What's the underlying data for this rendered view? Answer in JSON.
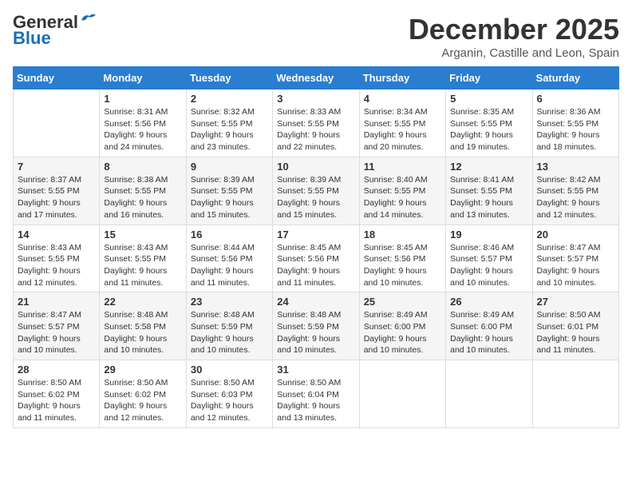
{
  "logo": {
    "line1": "General",
    "line2": "Blue"
  },
  "title": "December 2025",
  "location": "Arganin, Castille and Leon, Spain",
  "days_of_week": [
    "Sunday",
    "Monday",
    "Tuesday",
    "Wednesday",
    "Thursday",
    "Friday",
    "Saturday"
  ],
  "weeks": [
    [
      {
        "day": "",
        "info": ""
      },
      {
        "day": "1",
        "info": "Sunrise: 8:31 AM\nSunset: 5:56 PM\nDaylight: 9 hours\nand 24 minutes."
      },
      {
        "day": "2",
        "info": "Sunrise: 8:32 AM\nSunset: 5:55 PM\nDaylight: 9 hours\nand 23 minutes."
      },
      {
        "day": "3",
        "info": "Sunrise: 8:33 AM\nSunset: 5:55 PM\nDaylight: 9 hours\nand 22 minutes."
      },
      {
        "day": "4",
        "info": "Sunrise: 8:34 AM\nSunset: 5:55 PM\nDaylight: 9 hours\nand 20 minutes."
      },
      {
        "day": "5",
        "info": "Sunrise: 8:35 AM\nSunset: 5:55 PM\nDaylight: 9 hours\nand 19 minutes."
      },
      {
        "day": "6",
        "info": "Sunrise: 8:36 AM\nSunset: 5:55 PM\nDaylight: 9 hours\nand 18 minutes."
      }
    ],
    [
      {
        "day": "7",
        "info": "Sunrise: 8:37 AM\nSunset: 5:55 PM\nDaylight: 9 hours\nand 17 minutes."
      },
      {
        "day": "8",
        "info": "Sunrise: 8:38 AM\nSunset: 5:55 PM\nDaylight: 9 hours\nand 16 minutes."
      },
      {
        "day": "9",
        "info": "Sunrise: 8:39 AM\nSunset: 5:55 PM\nDaylight: 9 hours\nand 15 minutes."
      },
      {
        "day": "10",
        "info": "Sunrise: 8:39 AM\nSunset: 5:55 PM\nDaylight: 9 hours\nand 15 minutes."
      },
      {
        "day": "11",
        "info": "Sunrise: 8:40 AM\nSunset: 5:55 PM\nDaylight: 9 hours\nand 14 minutes."
      },
      {
        "day": "12",
        "info": "Sunrise: 8:41 AM\nSunset: 5:55 PM\nDaylight: 9 hours\nand 13 minutes."
      },
      {
        "day": "13",
        "info": "Sunrise: 8:42 AM\nSunset: 5:55 PM\nDaylight: 9 hours\nand 12 minutes."
      }
    ],
    [
      {
        "day": "14",
        "info": "Sunrise: 8:43 AM\nSunset: 5:55 PM\nDaylight: 9 hours\nand 12 minutes."
      },
      {
        "day": "15",
        "info": "Sunrise: 8:43 AM\nSunset: 5:55 PM\nDaylight: 9 hours\nand 11 minutes."
      },
      {
        "day": "16",
        "info": "Sunrise: 8:44 AM\nSunset: 5:56 PM\nDaylight: 9 hours\nand 11 minutes."
      },
      {
        "day": "17",
        "info": "Sunrise: 8:45 AM\nSunset: 5:56 PM\nDaylight: 9 hours\nand 11 minutes."
      },
      {
        "day": "18",
        "info": "Sunrise: 8:45 AM\nSunset: 5:56 PM\nDaylight: 9 hours\nand 10 minutes."
      },
      {
        "day": "19",
        "info": "Sunrise: 8:46 AM\nSunset: 5:57 PM\nDaylight: 9 hours\nand 10 minutes."
      },
      {
        "day": "20",
        "info": "Sunrise: 8:47 AM\nSunset: 5:57 PM\nDaylight: 9 hours\nand 10 minutes."
      }
    ],
    [
      {
        "day": "21",
        "info": "Sunrise: 8:47 AM\nSunset: 5:57 PM\nDaylight: 9 hours\nand 10 minutes."
      },
      {
        "day": "22",
        "info": "Sunrise: 8:48 AM\nSunset: 5:58 PM\nDaylight: 9 hours\nand 10 minutes."
      },
      {
        "day": "23",
        "info": "Sunrise: 8:48 AM\nSunset: 5:59 PM\nDaylight: 9 hours\nand 10 minutes."
      },
      {
        "day": "24",
        "info": "Sunrise: 8:48 AM\nSunset: 5:59 PM\nDaylight: 9 hours\nand 10 minutes."
      },
      {
        "day": "25",
        "info": "Sunrise: 8:49 AM\nSunset: 6:00 PM\nDaylight: 9 hours\nand 10 minutes."
      },
      {
        "day": "26",
        "info": "Sunrise: 8:49 AM\nSunset: 6:00 PM\nDaylight: 9 hours\nand 10 minutes."
      },
      {
        "day": "27",
        "info": "Sunrise: 8:50 AM\nSunset: 6:01 PM\nDaylight: 9 hours\nand 11 minutes."
      }
    ],
    [
      {
        "day": "28",
        "info": "Sunrise: 8:50 AM\nSunset: 6:02 PM\nDaylight: 9 hours\nand 11 minutes."
      },
      {
        "day": "29",
        "info": "Sunrise: 8:50 AM\nSunset: 6:02 PM\nDaylight: 9 hours\nand 12 minutes."
      },
      {
        "day": "30",
        "info": "Sunrise: 8:50 AM\nSunset: 6:03 PM\nDaylight: 9 hours\nand 12 minutes."
      },
      {
        "day": "31",
        "info": "Sunrise: 8:50 AM\nSunset: 6:04 PM\nDaylight: 9 hours\nand 13 minutes."
      },
      {
        "day": "",
        "info": ""
      },
      {
        "day": "",
        "info": ""
      },
      {
        "day": "",
        "info": ""
      }
    ]
  ]
}
